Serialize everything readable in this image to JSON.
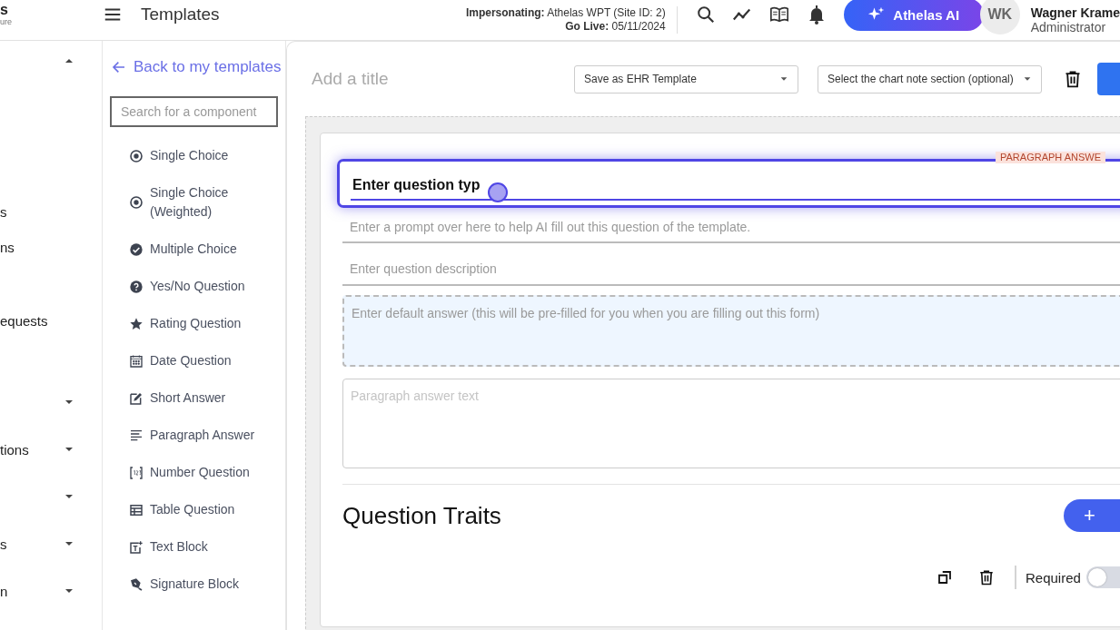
{
  "header": {
    "logo_text": "s",
    "logo_subtext": "ure",
    "title": "Templates",
    "impersonating_label": "Impersonating:",
    "impersonating_value": "Athelas WPT (Site ID: 2)",
    "go_live_label": "Go Live:",
    "go_live_value": "05/11/2024",
    "ai_button": "Athelas AI",
    "avatar_initials": "WK",
    "user_name": "Wagner Krame",
    "user_role": "Administrator"
  },
  "nav": {
    "items": [
      {
        "expanded": true
      },
      {
        "label": "s"
      },
      {
        "label": "ns"
      },
      {
        "label": "equests"
      },
      {
        "expanded": false
      },
      {
        "label": "tions",
        "expanded": false
      },
      {
        "expanded": false
      },
      {
        "label": "s",
        "expanded": false
      },
      {
        "label": "n",
        "expanded": false
      }
    ]
  },
  "components": {
    "back_link": "Back to my templates",
    "search": {
      "placeholder": "Search for a component"
    },
    "items": [
      {
        "kind": "radio",
        "label": "Single Choice"
      },
      {
        "kind": "radio",
        "label": "Single Choice (Weighted)"
      },
      {
        "kind": "check",
        "label": "Multiple Choice"
      },
      {
        "kind": "question",
        "label": "Yes/No Question"
      },
      {
        "kind": "star",
        "label": "Rating Question"
      },
      {
        "kind": "calendar",
        "label": "Date Question"
      },
      {
        "kind": "edit",
        "label": "Short Answer"
      },
      {
        "kind": "paragraph",
        "label": "Paragraph Answer"
      },
      {
        "kind": "number",
        "label": "Number Question"
      },
      {
        "kind": "table",
        "label": "Table Question"
      },
      {
        "kind": "textblock",
        "label": "Text Block"
      },
      {
        "kind": "signature",
        "label": "Signature Block"
      }
    ]
  },
  "editor": {
    "title": {
      "placeholder": "Add a title"
    },
    "dropdowns": [
      {
        "value": "Save as EHR Template"
      },
      {
        "value": "Select the chart note section (optional)"
      }
    ],
    "question": {
      "type_badge": "PARAGRAPH ANSWE",
      "value": "Enter question typ"
    },
    "prompt": {
      "placeholder": "Enter a prompt over here to help AI fill out this question of the template."
    },
    "description": {
      "placeholder": "Enter question description"
    },
    "default_answer": {
      "placeholder": "Enter default answer (this will be pre-filled for you when you are filling out this form)"
    },
    "answer": {
      "placeholder": "Paragraph answer text"
    },
    "traits_title": "Question Traits",
    "add_button": "+",
    "required": {
      "label": "Required",
      "on": false
    }
  }
}
